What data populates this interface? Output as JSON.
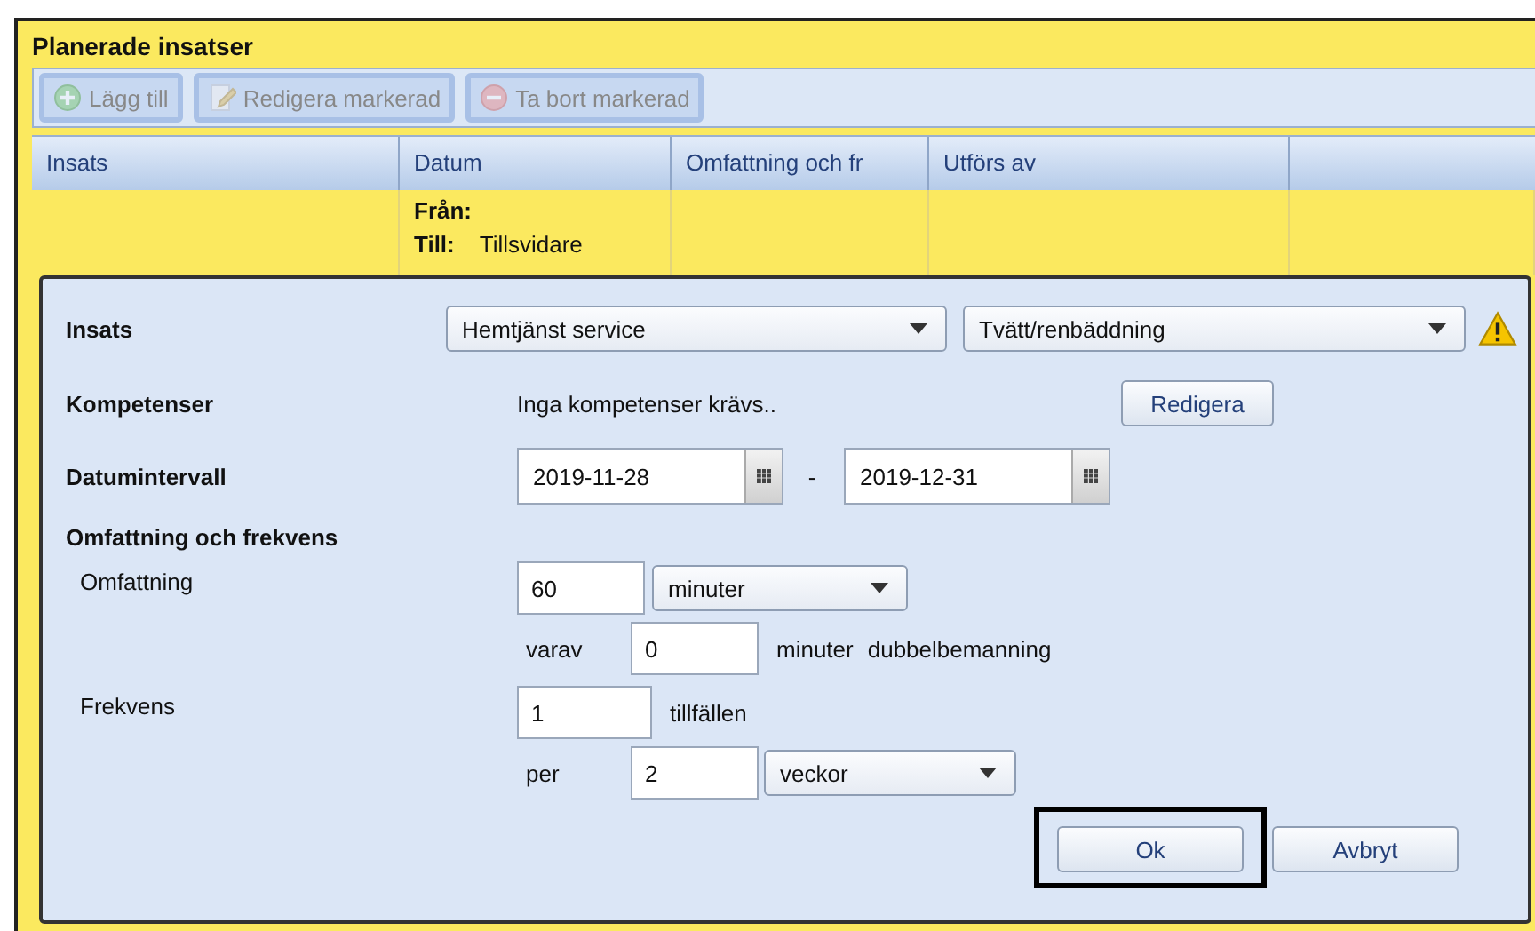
{
  "panel": {
    "title": "Planerade insatser"
  },
  "toolbar": [
    {
      "kind": "add",
      "label": "Lägg till",
      "disabled": true
    },
    {
      "kind": "edit",
      "label": "Redigera markerad",
      "disabled": true
    },
    {
      "kind": "remove",
      "label": "Ta bort markerad",
      "disabled": true
    }
  ],
  "table": {
    "columns": [
      "Insats",
      "Datum",
      "Omfattning och fr",
      "Utförs av"
    ],
    "rows": [
      {
        "from_label": "Från:",
        "to_label": "Till:",
        "to_value": "Tillsvidare"
      }
    ]
  },
  "dialog": {
    "insats": {
      "label": "Insats",
      "select_1": "Hemtjänst service",
      "select_2": "Tvätt/renbäddning",
      "warning": true
    },
    "kompetenser": {
      "label": "Kompetenser",
      "text": "Inga kompetenser krävs..",
      "button": "Redigera"
    },
    "datumintervall": {
      "label": "Datumintervall",
      "from": "2019-11-28",
      "separator": "-",
      "to": "2019-12-31"
    },
    "section": "Omfattning och frekvens",
    "omfattning": {
      "label": "Omfattning",
      "value": "60",
      "unit": "minuter",
      "sub_label": "varav",
      "sub_value": "0",
      "sub_unit": "minuter",
      "sub_suffix": "dubbelbemanning"
    },
    "frekvens": {
      "label": "Frekvens",
      "value": "1",
      "unit": "tillfällen",
      "sub_label": "per",
      "sub_value": "2",
      "sub_unit": "veckor"
    },
    "buttons": [
      {
        "label": "Ok",
        "highlighted": true
      },
      {
        "label": "Avbryt",
        "highlighted": false
      }
    ]
  }
}
